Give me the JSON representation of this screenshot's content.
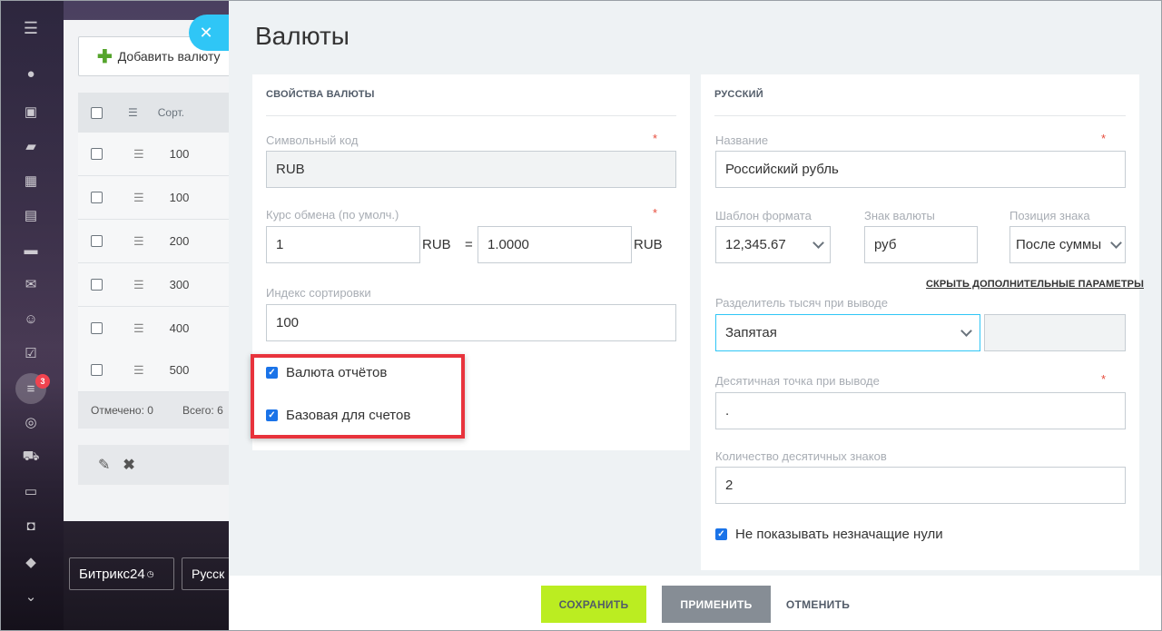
{
  "background": {
    "add_currency_label": "Добавить валюту",
    "grid_header_sort": "Сорт.",
    "rows": [
      "100",
      "100",
      "200",
      "300",
      "400",
      "500"
    ],
    "footer_checked": "Отмечено: 0",
    "footer_total": "Всего: 6",
    "logo_text": "Битрикс24",
    "language_label": "Русск",
    "notification_count": "3"
  },
  "slider": {
    "title": "Валюты",
    "close_glyph": "✕"
  },
  "left_card": {
    "heading": "СВОЙСТВА ВАЛЮТЫ",
    "symbol_code_label": "Символьный код",
    "symbol_code_value": "RUB",
    "rate_label": "Курс обмена (по умолч.)",
    "rate_amount": "1",
    "rate_currency_from": "RUB",
    "rate_equals": "=",
    "rate_value": "1.0000",
    "rate_currency_to": "RUB",
    "sort_label": "Индекс сортировки",
    "sort_value": "100",
    "report_currency_label": "Валюта отчётов",
    "base_for_invoices_label": "Базовая для счетов",
    "required_mark": "*"
  },
  "right_card": {
    "heading": "РУССКИЙ",
    "name_label": "Название",
    "name_value": "Российский рубль",
    "format_label": "Шаблон формата",
    "format_value": "12,345.67",
    "sign_label": "Знак валюты",
    "sign_value": "руб",
    "sign_position_label": "Позиция знака",
    "sign_position_value": "После суммы",
    "hide_params_link": "СКРЫТЬ ДОПОЛНИТЕЛЬНЫЕ ПАРАМЕТРЫ",
    "thousands_sep_label": "Разделитель тысяч при выводе",
    "thousands_sep_value": "Запятая",
    "decimal_point_label": "Десятичная точка при выводе",
    "decimal_point_value": ".",
    "decimals_label": "Количество десятичных знаков",
    "decimals_value": "2",
    "hide_zeros_label": "Не показывать незначащие нули",
    "required_mark": "*"
  },
  "footer": {
    "save": "СОХРАНИТЬ",
    "apply": "ПРИМЕНИТЬ",
    "cancel": "ОТМЕНИТЬ"
  }
}
